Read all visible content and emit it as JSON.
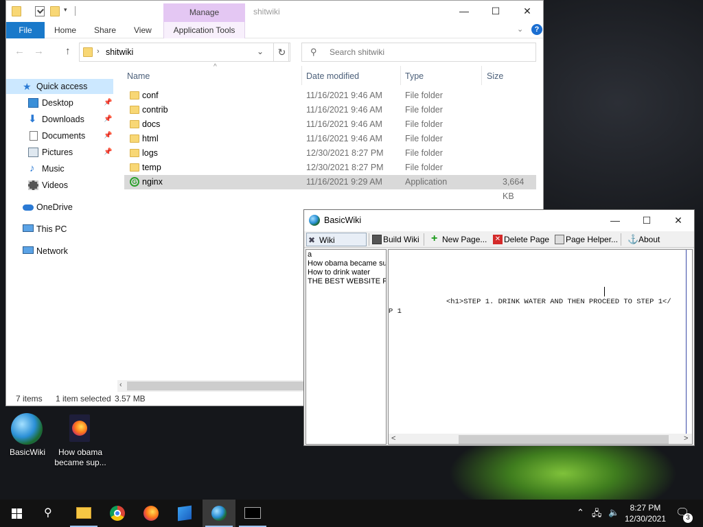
{
  "explorer": {
    "title": "shitwiki",
    "manage_tab": "Manage",
    "ribbon_tabs": {
      "file": "File",
      "home": "Home",
      "share": "Share",
      "view": "View",
      "app_tools": "Application Tools"
    },
    "address_path": "shitwiki",
    "search_placeholder": "Search shitwiki",
    "nav": {
      "quick_access": "Quick access",
      "desktop": "Desktop",
      "downloads": "Downloads",
      "documents": "Documents",
      "pictures": "Pictures",
      "music": "Music",
      "videos": "Videos",
      "onedrive": "OneDrive",
      "this_pc": "This PC",
      "network": "Network"
    },
    "columns": {
      "name": "Name",
      "date": "Date modified",
      "type": "Type",
      "size": "Size"
    },
    "files": [
      {
        "name": "conf",
        "date": "11/16/2021 9:46 AM",
        "type": "File folder",
        "size": ""
      },
      {
        "name": "contrib",
        "date": "11/16/2021 9:46 AM",
        "type": "File folder",
        "size": ""
      },
      {
        "name": "docs",
        "date": "11/16/2021 9:46 AM",
        "type": "File folder",
        "size": ""
      },
      {
        "name": "html",
        "date": "11/16/2021 9:46 AM",
        "type": "File folder",
        "size": ""
      },
      {
        "name": "logs",
        "date": "12/30/2021 8:27 PM",
        "type": "File folder",
        "size": ""
      },
      {
        "name": "temp",
        "date": "12/30/2021 8:27 PM",
        "type": "File folder",
        "size": ""
      },
      {
        "name": "nginx",
        "date": "11/16/2021 9:29 AM",
        "type": "Application",
        "size": "3,664 KB"
      }
    ],
    "status": {
      "items": "7 items",
      "selected": "1 item selected",
      "size": "3.57 MB"
    }
  },
  "basicwiki": {
    "title": "BasicWiki",
    "toolbar": {
      "wiki_settings": "Wiki Settings",
      "build_wiki": "Build Wiki",
      "new_page": "New Page...",
      "delete_page": "Delete Page",
      "page_helper": "Page Helper...",
      "about": "About"
    },
    "pages": [
      "a",
      "How obama became sup",
      "How to drink water",
      "THE BEST WEBSITE F"
    ],
    "editor_line1": "<h1>STEP 1. DRINK WATER AND THEN PROCEED TO STEP 1</",
    "editor_line2": "P 1"
  },
  "desktop": {
    "icons": [
      {
        "label": "BasicWiki"
      },
      {
        "label": "How obama became sup..."
      }
    ]
  },
  "taskbar": {
    "time": "8:27 PM",
    "date": "12/30/2021",
    "notifications": "3"
  },
  "colors": {
    "accent": "#1979ca",
    "manage_tab": "#e4c7f3",
    "selection": "#cce8ff"
  }
}
